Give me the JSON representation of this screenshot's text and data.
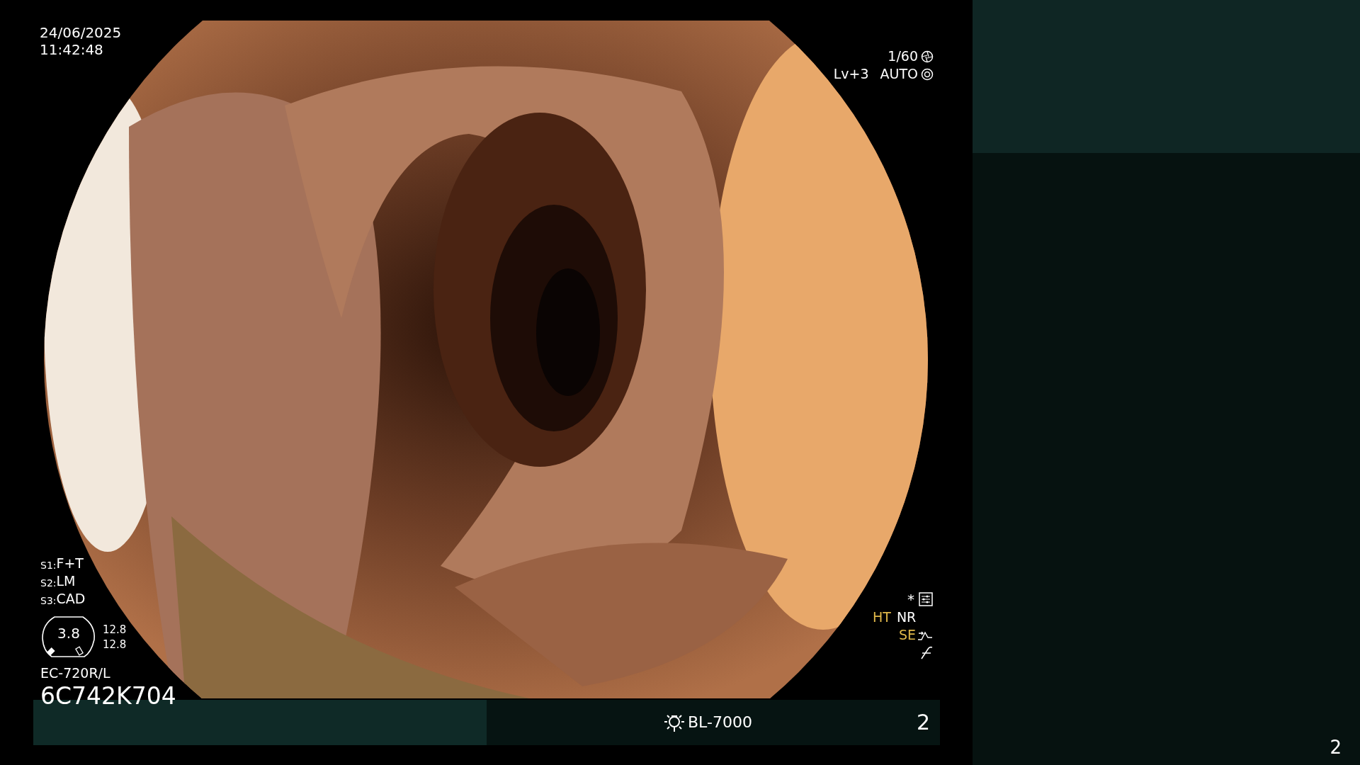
{
  "timestamp": {
    "date": "24/06/2025",
    "time": "11:42:48"
  },
  "exposure": {
    "shutter": "1/60",
    "level": "Lv+3",
    "mode": "AUTO"
  },
  "scope_settings": [
    {
      "label": "S1:",
      "value": "F+T"
    },
    {
      "label": "S2:",
      "value": "LM"
    },
    {
      "label": "S3:",
      "value": "CAD"
    }
  ],
  "gauge": {
    "value": "3.8",
    "readings": [
      "12.8",
      "12.8"
    ]
  },
  "scope": {
    "model": "EC-720R/L",
    "serial": "6C742K704"
  },
  "indicators": {
    "mark": "*",
    "modes": [
      {
        "label": "HT",
        "color": "#e0b84a"
      },
      {
        "label": "NR",
        "color": "#ffffff"
      }
    ],
    "enhancement": {
      "label": "SE",
      "color": "#e0b84a"
    }
  },
  "status_bar": {
    "light_source": "BL-7000",
    "channel": "2"
  },
  "side_panel": {
    "channel": "2"
  }
}
